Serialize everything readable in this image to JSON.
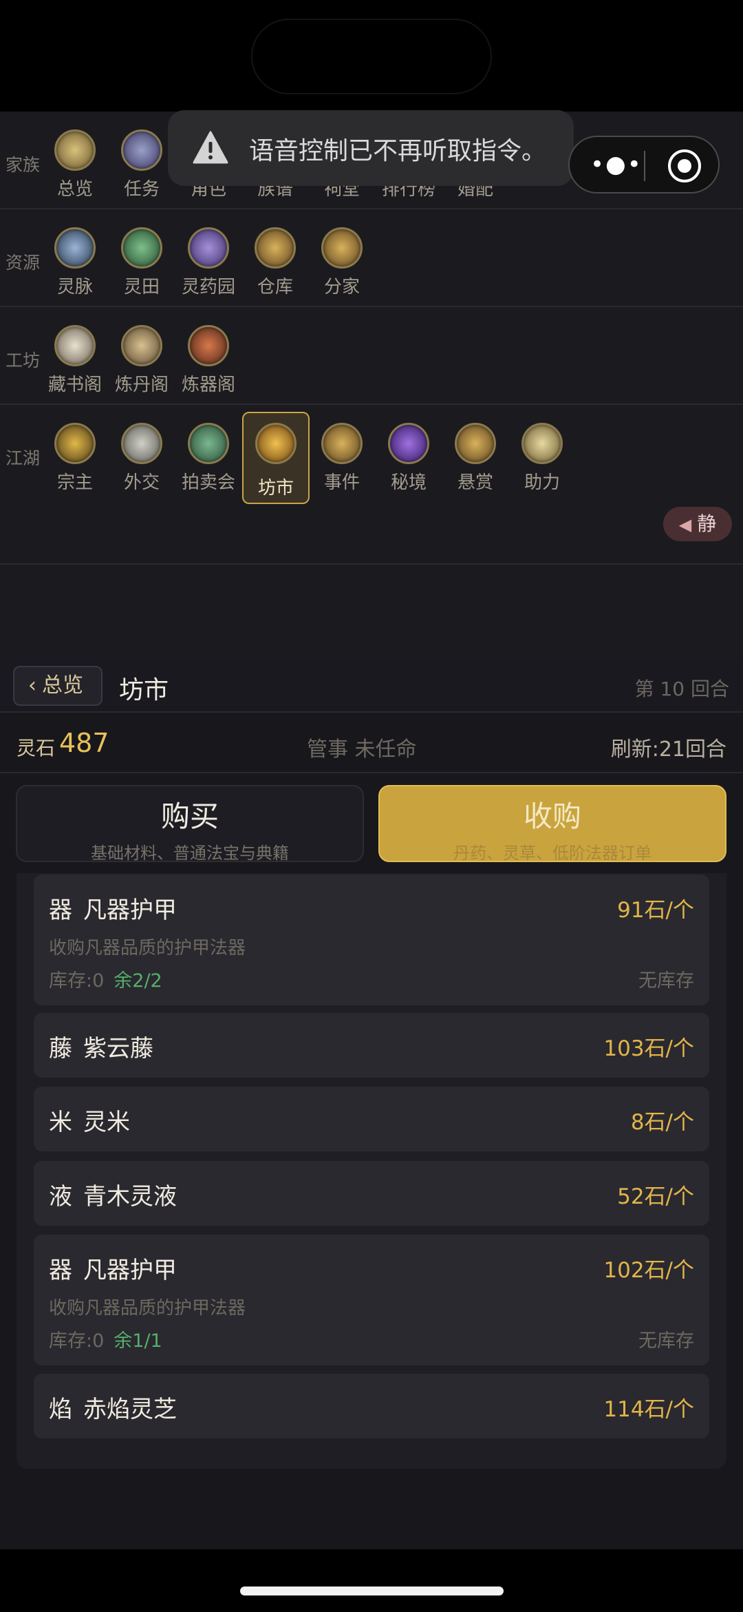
{
  "nav": {
    "rows": [
      {
        "label": "家族",
        "items": [
          "总览",
          "任务",
          "角色",
          "族谱",
          "祠堂",
          "排行榜",
          "婚配"
        ]
      },
      {
        "label": "资源",
        "items": [
          "灵脉",
          "灵田",
          "灵药园",
          "仓库",
          "分家"
        ]
      },
      {
        "label": "工坊",
        "items": [
          "藏书阁",
          "炼丹阁",
          "炼器阁"
        ]
      },
      {
        "label": "江湖",
        "items": [
          "宗主",
          "外交",
          "拍卖会",
          "坊市",
          "事件",
          "秘境",
          "悬赏",
          "助力"
        ]
      }
    ],
    "active": "坊市",
    "mute_label": "静"
  },
  "toast": {
    "text": "语音控制已不再听取指令。"
  },
  "market": {
    "back_label": "总览",
    "title": "坊市",
    "round": "第 10 回合",
    "stone_label": "灵石",
    "stone_value": "487",
    "steward": "管事 未任命",
    "refresh": "刷新:21回合",
    "tabs": {
      "buy": {
        "title": "购买",
        "sub": "基础材料、普通法宝与典籍"
      },
      "sell": {
        "title": "收购",
        "sub": "丹药、灵草、低阶法器订单"
      }
    },
    "items": [
      {
        "kind": "器",
        "name": "凡器护甲",
        "price": "91石/个",
        "desc": "收购凡器品质的护甲法器",
        "stock": "库存:0",
        "remain": "余2/2",
        "status": "无库存"
      },
      {
        "kind": "藤",
        "name": "紫云藤",
        "price": "103石/个"
      },
      {
        "kind": "米",
        "name": "灵米",
        "price": "8石/个"
      },
      {
        "kind": "液",
        "name": "青木灵液",
        "price": "52石/个"
      },
      {
        "kind": "器",
        "name": "凡器护甲",
        "price": "102石/个",
        "desc": "收购凡器品质的护甲法器",
        "stock": "库存:0",
        "remain": "余1/1",
        "status": "无库存"
      },
      {
        "kind": "焰",
        "name": "赤焰灵芝",
        "price": "114石/个"
      }
    ]
  },
  "colors": {
    "accent_gold": "#c9a43e",
    "price": "#e2b54a",
    "remain_green": "#55b06a"
  }
}
